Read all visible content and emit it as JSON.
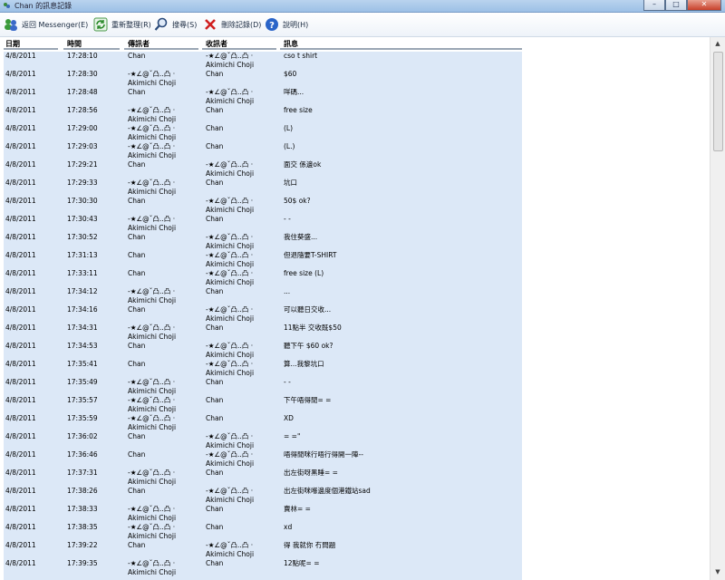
{
  "window": {
    "title": "Chan 的訊息記錄"
  },
  "toolbar": {
    "back": "返回 Messenger(E)",
    "refresh": "重新整理(R)",
    "search": "搜尋(S)",
    "delete": "刪除記錄(D)",
    "help": "說明(H)"
  },
  "colors": {
    "row_bg": "#dce8f7",
    "toolbar_bg": "#eef3f9"
  },
  "columns": [
    "日期",
    "時間",
    "傳訊者",
    "收訊者",
    "訊息"
  ],
  "rows": [
    [
      "4/8/2011",
      "17:28:10",
      "Chan",
      "-★∠@ˇ凸‥凸 ‧\nAkimichi Choji",
      "cso t shirt"
    ],
    [
      "4/8/2011",
      "17:28:30",
      "-★∠@ˇ凸‥凸 ‧\nAkimichi Choji",
      "Chan",
      "$60"
    ],
    [
      "4/8/2011",
      "17:28:48",
      "Chan",
      "-★∠@ˇ凸‥凸 ‧\nAkimichi Choji",
      "咩碼..."
    ],
    [
      "4/8/2011",
      "17:28:56",
      "-★∠@ˇ凸‥凸 ‧\nAkimichi Choji",
      "Chan",
      "free size"
    ],
    [
      "4/8/2011",
      "17:29:00",
      "-★∠@ˇ凸‥凸 ‧\nAkimichi Choji",
      "Chan",
      "(L)"
    ],
    [
      "4/8/2011",
      "17:29:03",
      "-★∠@ˇ凸‥凸 ‧\nAkimichi Choji",
      "Chan",
      "(L.)"
    ],
    [
      "4/8/2011",
      "17:29:21",
      "Chan",
      "-★∠@ˇ凸‥凸 ‧\nAkimichi Choji",
      "面交 係邊ok"
    ],
    [
      "4/8/2011",
      "17:29:33",
      "-★∠@ˇ凸‥凸 ‧\nAkimichi Choji",
      "Chan",
      "坑口"
    ],
    [
      "4/8/2011",
      "17:30:30",
      "Chan",
      "-★∠@ˇ凸‥凸 ‧\nAkimichi Choji",
      "50$ ok?"
    ],
    [
      "4/8/2011",
      "17:30:43",
      "-★∠@ˇ凸‥凸 ‧\nAkimichi Choji",
      "Chan",
      "- -"
    ],
    [
      "4/8/2011",
      "17:30:52",
      "Chan",
      "-★∠@ˇ凸‥凸 ‧\nAkimichi Choji",
      "我住葵盛..."
    ],
    [
      "4/8/2011",
      "17:31:13",
      "Chan",
      "-★∠@ˇ凸‥凸 ‧\nAkimichi Choji",
      "但退隨要T-SHIRT"
    ],
    [
      "4/8/2011",
      "17:33:11",
      "Chan",
      "-★∠@ˇ凸‥凸 ‧\nAkimichi Choji",
      "free size (L)"
    ],
    [
      "4/8/2011",
      "17:34:12",
      "-★∠@ˇ凸‥凸 ‧\nAkimichi Choji",
      "Chan",
      "..."
    ],
    [
      "4/8/2011",
      "17:34:16",
      "Chan",
      "-★∠@ˇ凸‥凸 ‧\nAkimichi Choji",
      "可以聽日交收..."
    ],
    [
      "4/8/2011",
      "17:34:31",
      "-★∠@ˇ凸‥凸 ‧\nAkimichi Choji",
      "Chan",
      "11點半 交收既$50"
    ],
    [
      "4/8/2011",
      "17:34:53",
      "Chan",
      "-★∠@ˇ凸‥凸 ‧\nAkimichi Choji",
      "聽下午 $60 ok?"
    ],
    [
      "4/8/2011",
      "17:35:41",
      "Chan",
      "-★∠@ˇ凸‥凸 ‧\nAkimichi Choji",
      "算...我黎坑口"
    ],
    [
      "4/8/2011",
      "17:35:49",
      "-★∠@ˇ凸‥凸 ‧\nAkimichi Choji",
      "Chan",
      "- -"
    ],
    [
      "4/8/2011",
      "17:35:57",
      "-★∠@ˇ凸‥凸 ‧\nAkimichi Choji",
      "Chan",
      "下午唔得閒= ="
    ],
    [
      "4/8/2011",
      "17:35:59",
      "-★∠@ˇ凸‥凸 ‧\nAkimichi Choji",
      "Chan",
      "XD"
    ],
    [
      "4/8/2011",
      "17:36:02",
      "Chan",
      "-★∠@ˇ凸‥凸 ‧\nAkimichi Choji",
      "= =\""
    ],
    [
      "4/8/2011",
      "17:36:46",
      "Chan",
      "-★∠@ˇ凸‥凸 ‧\nAkimichi Choji",
      "唔得閒咪行唔行得開一陣--"
    ],
    [
      "4/8/2011",
      "17:37:31",
      "-★∠@ˇ凸‥凸 ‧\nAkimichi Choji",
      "Chan",
      "出左街呀黑睡= ="
    ],
    [
      "4/8/2011",
      "17:38:26",
      "Chan",
      "-★∠@ˇ凸‥凸 ‧\nAkimichi Choji",
      "出左街咪喺邊度個港鐵站sad"
    ],
    [
      "4/8/2011",
      "17:38:33",
      "-★∠@ˇ凸‥凸 ‧\nAkimichi Choji",
      "Chan",
      "賣林= ="
    ],
    [
      "4/8/2011",
      "17:38:35",
      "-★∠@ˇ凸‥凸 ‧\nAkimichi Choji",
      "Chan",
      "xd"
    ],
    [
      "4/8/2011",
      "17:39:22",
      "Chan",
      "-★∠@ˇ凸‥凸 ‧\nAkimichi Choji",
      "得 我就你 冇問題"
    ],
    [
      "4/8/2011",
      "17:39:35",
      "-★∠@ˇ凸‥凸 ‧\nAkimichi Choji",
      "Chan",
      "12點呢= ="
    ]
  ]
}
